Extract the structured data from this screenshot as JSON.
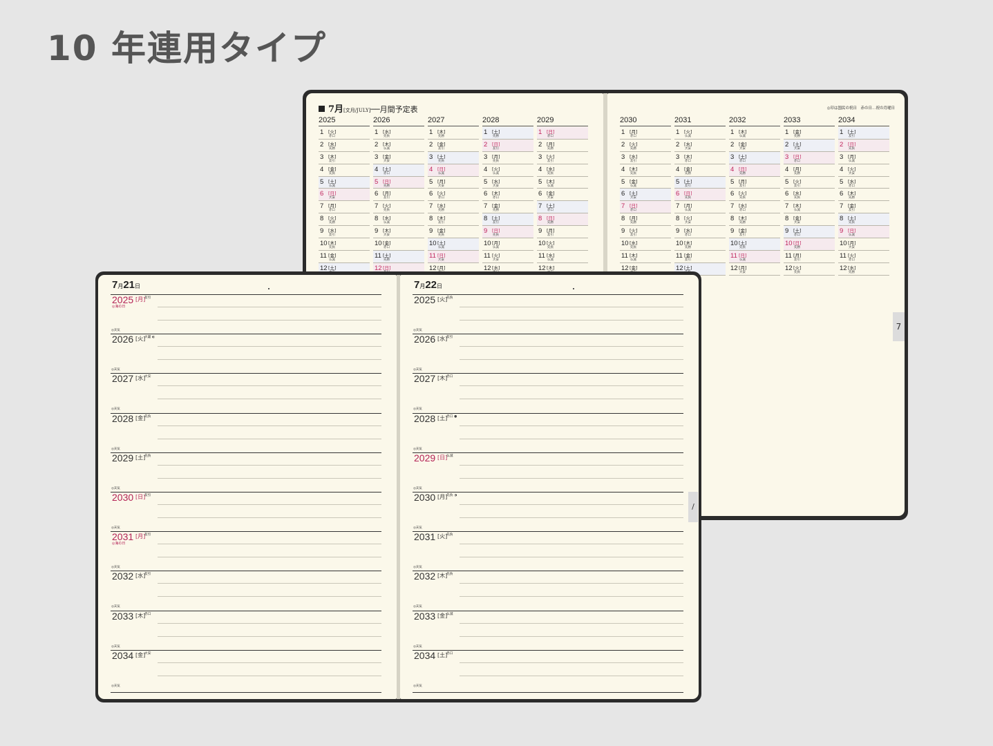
{
  "heading": "10 年連用タイプ",
  "monthly": {
    "title_mark": "7月",
    "title_sub": "[文月/JULY]",
    "title_rest": "──月間予定表",
    "note": "◎印は国民の祝日　赤の日…祝の月曜日",
    "tab": "7",
    "years_left": [
      "2025",
      "2026",
      "2027",
      "2028",
      "2029"
    ],
    "years_right": [
      "2030",
      "2031",
      "2032",
      "2033",
      "2034"
    ],
    "columns": [
      {
        "year": "2025",
        "days": [
          {
            "n": "1",
            "w": "[火]",
            "r": "赤口"
          },
          {
            "n": "2",
            "w": "[水]",
            "r": "先勝"
          },
          {
            "n": "3",
            "w": "[木]",
            "r": "友引"
          },
          {
            "n": "4",
            "w": "[金]",
            "r": "先負"
          },
          {
            "n": "5",
            "w": "[土]",
            "r": "仏滅",
            "t": "sat"
          },
          {
            "n": "6",
            "w": "[日]",
            "r": "大安",
            "t": "sun"
          },
          {
            "n": "7",
            "w": "[月]",
            "r": "赤口"
          },
          {
            "n": "8",
            "w": "[火]",
            "r": "先勝"
          },
          {
            "n": "9",
            "w": "[水]",
            "r": "友引"
          },
          {
            "n": "10",
            "w": "[木]",
            "r": "先負"
          },
          {
            "n": "11",
            "w": "[金]",
            "r": "仏滅"
          },
          {
            "n": "12",
            "w": "[土]",
            "r": "大安",
            "t": "sat"
          }
        ]
      },
      {
        "year": "2026",
        "days": [
          {
            "n": "1",
            "w": "[水]",
            "r": "先負"
          },
          {
            "n": "2",
            "w": "[木]",
            "r": "仏滅"
          },
          {
            "n": "3",
            "w": "[金]",
            "r": "大安"
          },
          {
            "n": "4",
            "w": "[土]",
            "r": "赤口",
            "t": "sat"
          },
          {
            "n": "5",
            "w": "[日]",
            "r": "先勝",
            "t": "sun"
          },
          {
            "n": "6",
            "w": "[月]",
            "r": "友引"
          },
          {
            "n": "7",
            "w": "[火]",
            "r": "先負"
          },
          {
            "n": "8",
            "w": "[水]",
            "r": "仏滅"
          },
          {
            "n": "9",
            "w": "[木]",
            "r": "大安"
          },
          {
            "n": "10",
            "w": "[金]",
            "r": "赤口"
          },
          {
            "n": "11",
            "w": "[土]",
            "r": "先勝",
            "t": "sat"
          },
          {
            "n": "12",
            "w": "[日]",
            "r": "友引",
            "t": "sun"
          }
        ]
      },
      {
        "year": "2027",
        "days": [
          {
            "n": "1",
            "w": "[木]",
            "r": "先勝"
          },
          {
            "n": "2",
            "w": "[金]",
            "r": "友引"
          },
          {
            "n": "3",
            "w": "[土]",
            "r": "先負",
            "t": "sat"
          },
          {
            "n": "4",
            "w": "[日]",
            "r": "仏滅",
            "t": "sun"
          },
          {
            "n": "5",
            "w": "[月]",
            "r": "大安"
          },
          {
            "n": "6",
            "w": "[火]",
            "r": "赤口"
          },
          {
            "n": "7",
            "w": "[水]",
            "r": "先勝"
          },
          {
            "n": "8",
            "w": "[木]",
            "r": "友引"
          },
          {
            "n": "9",
            "w": "[金]",
            "r": "先負"
          },
          {
            "n": "10",
            "w": "[土]",
            "r": "仏滅",
            "t": "sat"
          },
          {
            "n": "11",
            "w": "[日]",
            "r": "大安",
            "t": "sun"
          },
          {
            "n": "12",
            "w": "[月]",
            "r": "赤口"
          }
        ]
      },
      {
        "year": "2028",
        "days": [
          {
            "n": "1",
            "w": "[土]",
            "r": "先勝",
            "t": "sat"
          },
          {
            "n": "2",
            "w": "[日]",
            "r": "友引",
            "t": "sun"
          },
          {
            "n": "3",
            "w": "[月]",
            "r": "先負"
          },
          {
            "n": "4",
            "w": "[火]",
            "r": "仏滅"
          },
          {
            "n": "5",
            "w": "[水]",
            "r": "大安"
          },
          {
            "n": "6",
            "w": "[木]",
            "r": "赤口"
          },
          {
            "n": "7",
            "w": "[金]",
            "r": "先勝"
          },
          {
            "n": "8",
            "w": "[土]",
            "r": "友引",
            "t": "sat"
          },
          {
            "n": "9",
            "w": "[日]",
            "r": "先負",
            "t": "sun"
          },
          {
            "n": "10",
            "w": "[月]",
            "r": "仏滅"
          },
          {
            "n": "11",
            "w": "[火]",
            "r": "大安"
          },
          {
            "n": "12",
            "w": "[水]",
            "r": "赤口"
          }
        ]
      },
      {
        "year": "2029",
        "days": [
          {
            "n": "1",
            "w": "[日]",
            "r": "赤口",
            "t": "sun"
          },
          {
            "n": "2",
            "w": "[月]",
            "r": "先勝"
          },
          {
            "n": "3",
            "w": "[火]",
            "r": "友引"
          },
          {
            "n": "4",
            "w": "[水]",
            "r": "先負"
          },
          {
            "n": "5",
            "w": "[木]",
            "r": "仏滅"
          },
          {
            "n": "6",
            "w": "[金]",
            "r": "大安"
          },
          {
            "n": "7",
            "w": "[土]",
            "r": "赤口",
            "t": "sat"
          },
          {
            "n": "8",
            "w": "[日]",
            "r": "先勝",
            "t": "sun"
          },
          {
            "n": "9",
            "w": "[月]",
            "r": "友引"
          },
          {
            "n": "10",
            "w": "[火]",
            "r": "先負"
          },
          {
            "n": "11",
            "w": "[水]",
            "r": "仏滅"
          },
          {
            "n": "12",
            "w": "[木]",
            "r": "大安"
          }
        ]
      },
      {
        "year": "2030",
        "days": [
          {
            "n": "1",
            "w": "[月]",
            "r": "赤口"
          },
          {
            "n": "2",
            "w": "[火]",
            "r": "先勝"
          },
          {
            "n": "3",
            "w": "[水]",
            "r": "友引"
          },
          {
            "n": "4",
            "w": "[木]",
            "r": "先負"
          },
          {
            "n": "5",
            "w": "[金]",
            "r": "仏滅"
          },
          {
            "n": "6",
            "w": "[土]",
            "r": "大安",
            "t": "sat"
          },
          {
            "n": "7",
            "w": "[日]",
            "r": "赤口",
            "t": "sun"
          },
          {
            "n": "8",
            "w": "[月]",
            "r": "先勝"
          },
          {
            "n": "9",
            "w": "[火]",
            "r": "友引"
          },
          {
            "n": "10",
            "w": "[水]",
            "r": "先負"
          },
          {
            "n": "11",
            "w": "[木]",
            "r": "仏滅"
          },
          {
            "n": "12",
            "w": "[金]",
            "r": "大安"
          }
        ]
      },
      {
        "year": "2031",
        "days": [
          {
            "n": "1",
            "w": "[火]",
            "r": "仏滅"
          },
          {
            "n": "2",
            "w": "[水]",
            "r": "大安"
          },
          {
            "n": "3",
            "w": "[木]",
            "r": "赤口"
          },
          {
            "n": "4",
            "w": "[金]",
            "r": "先勝"
          },
          {
            "n": "5",
            "w": "[土]",
            "r": "友引",
            "t": "sat"
          },
          {
            "n": "6",
            "w": "[日]",
            "r": "先負",
            "t": "sun"
          },
          {
            "n": "7",
            "w": "[月]",
            "r": "仏滅"
          },
          {
            "n": "8",
            "w": "[火]",
            "r": "大安"
          },
          {
            "n": "9",
            "w": "[水]",
            "r": "赤口"
          },
          {
            "n": "10",
            "w": "[木]",
            "r": "先勝"
          },
          {
            "n": "11",
            "w": "[金]",
            "r": "友引"
          },
          {
            "n": "12",
            "w": "[土]",
            "r": "先負",
            "t": "sat"
          }
        ]
      },
      {
        "year": "2032",
        "days": [
          {
            "n": "1",
            "w": "[木]",
            "r": "仏滅"
          },
          {
            "n": "2",
            "w": "[金]",
            "r": "大安"
          },
          {
            "n": "3",
            "w": "[土]",
            "r": "赤口",
            "t": "sat"
          },
          {
            "n": "4",
            "w": "[日]",
            "r": "先勝",
            "t": "sun"
          },
          {
            "n": "5",
            "w": "[月]",
            "r": "友引"
          },
          {
            "n": "6",
            "w": "[火]",
            "r": "先負"
          },
          {
            "n": "7",
            "w": "[水]",
            "r": "赤口"
          },
          {
            "n": "8",
            "w": "[木]",
            "r": "先勝"
          },
          {
            "n": "9",
            "w": "[金]",
            "r": "友引"
          },
          {
            "n": "10",
            "w": "[土]",
            "r": "先負",
            "t": "sat"
          },
          {
            "n": "11",
            "w": "[日]",
            "r": "仏滅",
            "t": "sun"
          },
          {
            "n": "12",
            "w": "[月]",
            "r": "大安"
          }
        ]
      },
      {
        "year": "2033",
        "days": [
          {
            "n": "1",
            "w": "[金]",
            "r": "先勝"
          },
          {
            "n": "2",
            "w": "[土]",
            "r": "大安",
            "t": "sat"
          },
          {
            "n": "3",
            "w": "[日]",
            "r": "赤口",
            "t": "sun"
          },
          {
            "n": "4",
            "w": "[月]",
            "r": "先勝"
          },
          {
            "n": "5",
            "w": "[火]",
            "r": "友引"
          },
          {
            "n": "6",
            "w": "[水]",
            "r": "先負"
          },
          {
            "n": "7",
            "w": "[木]",
            "r": "仏滅"
          },
          {
            "n": "8",
            "w": "[金]",
            "r": "大安"
          },
          {
            "n": "9",
            "w": "[土]",
            "r": "赤口",
            "t": "sat"
          },
          {
            "n": "10",
            "w": "[日]",
            "r": "先勝",
            "t": "sun"
          },
          {
            "n": "11",
            "w": "[月]",
            "r": "友引"
          },
          {
            "n": "12",
            "w": "[火]",
            "r": "先負"
          }
        ]
      },
      {
        "year": "2034",
        "days": [
          {
            "n": "1",
            "w": "[土]",
            "r": "友引",
            "t": "sat"
          },
          {
            "n": "2",
            "w": "[日]",
            "r": "先負",
            "t": "sun"
          },
          {
            "n": "3",
            "w": "[月]",
            "r": "仏滅"
          },
          {
            "n": "4",
            "w": "[火]",
            "r": "大安"
          },
          {
            "n": "5",
            "w": "[水]",
            "r": "赤口"
          },
          {
            "n": "6",
            "w": "[木]",
            "r": "先勝"
          },
          {
            "n": "7",
            "w": "[金]",
            "r": "友引"
          },
          {
            "n": "8",
            "w": "[土]",
            "r": "先負",
            "t": "sat"
          },
          {
            "n": "9",
            "w": "[日]",
            "r": "仏滅",
            "t": "sun"
          },
          {
            "n": "10",
            "w": "[月]",
            "r": "大安"
          },
          {
            "n": "11",
            "w": "[火]",
            "r": "赤口"
          },
          {
            "n": "12",
            "w": "[水]",
            "r": "先勝"
          }
        ]
      }
    ]
  },
  "daily_left": {
    "title_day": "7",
    "title_m": "月",
    "title_num": "21",
    "title_d": "日",
    "entries": [
      {
        "year": "2025",
        "wd": "[月]",
        "rk": "友引",
        "hol": "◎海の日",
        "red": true,
        "wdred": true
      },
      {
        "year": "2026",
        "wd": "[火]",
        "rk": "大暑 ◐"
      },
      {
        "year": "2027",
        "wd": "[水]",
        "rk": "大安"
      },
      {
        "year": "2028",
        "wd": "[金]",
        "rk": "先負"
      },
      {
        "year": "2029",
        "wd": "[土]",
        "rk": "先負"
      },
      {
        "year": "2030",
        "wd": "[日]",
        "rk": "友引",
        "red": true,
        "wdred": true
      },
      {
        "year": "2031",
        "wd": "[月]",
        "rk": "友引",
        "hol": "◎海の日",
        "red": true,
        "wdred": true
      },
      {
        "year": "2032",
        "wd": "[水]",
        "rk": "友引"
      },
      {
        "year": "2033",
        "wd": "[木]",
        "rk": "赤口"
      },
      {
        "year": "2034",
        "wd": "[金]",
        "rk": "大安"
      }
    ],
    "weather": "◎天気"
  },
  "daily_right": {
    "title_day": "7",
    "title_m": "月",
    "title_num": "22",
    "title_d": "日",
    "entries": [
      {
        "year": "2025",
        "wd": "[火]",
        "rk": "先負"
      },
      {
        "year": "2026",
        "wd": "[水]",
        "rk": "友引"
      },
      {
        "year": "2027",
        "wd": "[木]",
        "rk": "赤口"
      },
      {
        "year": "2028",
        "wd": "[土]",
        "rk": "赤口 ●"
      },
      {
        "year": "2029",
        "wd": "[日]",
        "rk": "仏滅",
        "red": true,
        "wdred": true
      },
      {
        "year": "2030",
        "wd": "[月]",
        "rk": "先負 ◑"
      },
      {
        "year": "2031",
        "wd": "[火]",
        "rk": "先負"
      },
      {
        "year": "2032",
        "wd": "[木]",
        "rk": "先負"
      },
      {
        "year": "2033",
        "wd": "[金]",
        "rk": "仏滅"
      },
      {
        "year": "2034",
        "wd": "[土]",
        "rk": "赤口"
      }
    ],
    "weather": "◎天気"
  },
  "tab_right": "/",
  "colors": {
    "accent_red": "#c0245c",
    "paper": "#fbf8ea",
    "cover": "#2b2b2b",
    "background": "#e6e6e6"
  }
}
